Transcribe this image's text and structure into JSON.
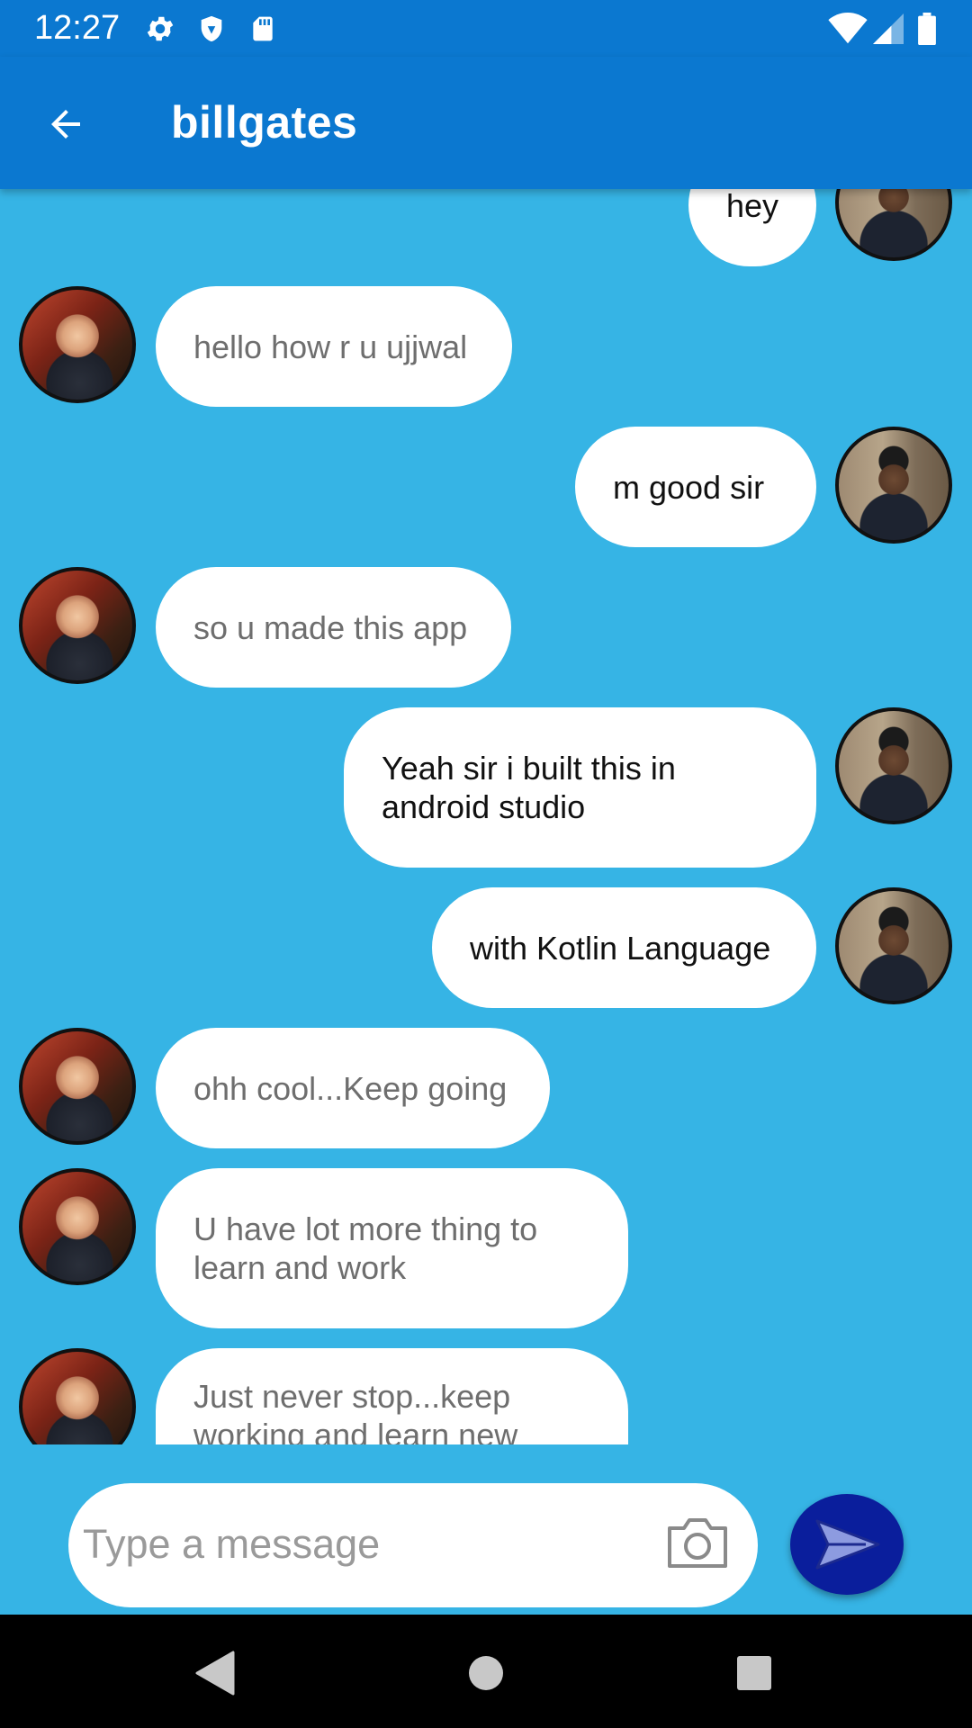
{
  "status_bar": {
    "time": "12:27",
    "icons_left": [
      "gear-icon",
      "shield-icon",
      "sd-card-icon"
    ],
    "icons_right": [
      "wifi-icon",
      "signal-icon",
      "battery-icon"
    ]
  },
  "app_bar": {
    "title": "billgates",
    "back_icon": "arrow-left-icon",
    "color": "#0b78d0"
  },
  "colors": {
    "chat_background": "#36b4e5",
    "bubble": "#ffffff",
    "outgoing_text": "#111111",
    "incoming_text": "#6e6e6e",
    "send_button": "#0a1e9c"
  },
  "messages": [
    {
      "sender": "me",
      "text": "hey"
    },
    {
      "sender": "them",
      "text": "hello how r u ujjwal"
    },
    {
      "sender": "me",
      "text": "m good sir"
    },
    {
      "sender": "them",
      "text": "so u made this app"
    },
    {
      "sender": "me",
      "text": "Yeah sir i built this in android studio"
    },
    {
      "sender": "me",
      "text": "with Kotlin Language"
    },
    {
      "sender": "them",
      "text": "ohh cool...Keep going"
    },
    {
      "sender": "them",
      "text": "U have lot more thing to learn and work"
    },
    {
      "sender": "them",
      "text": "Just never stop...keep working and learn new"
    }
  ],
  "composer": {
    "placeholder": "Type a message",
    "value": "",
    "camera_icon": "camera-icon",
    "send_icon": "send-icon"
  },
  "nav_bar": {
    "icons": [
      "back-triangle-icon",
      "home-circle-icon",
      "recents-square-icon"
    ]
  }
}
